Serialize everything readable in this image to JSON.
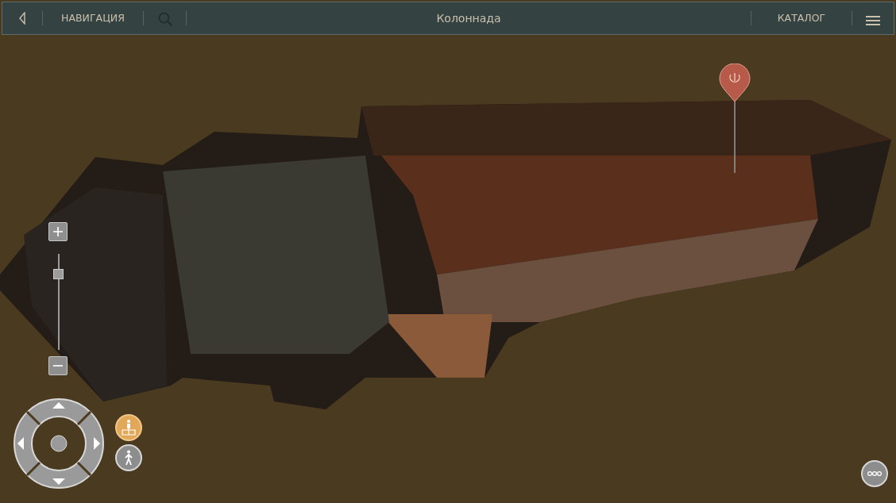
{
  "header": {
    "navigation_label": "НАВИГАЦИЯ",
    "title": "Колоннада",
    "catalog_label": "КАТАЛОГ"
  },
  "zoom_slider": {
    "level": 0.79
  },
  "view_modes": [
    {
      "kind": "overview",
      "selected": true
    },
    {
      "kind": "walk",
      "selected": false
    }
  ]
}
